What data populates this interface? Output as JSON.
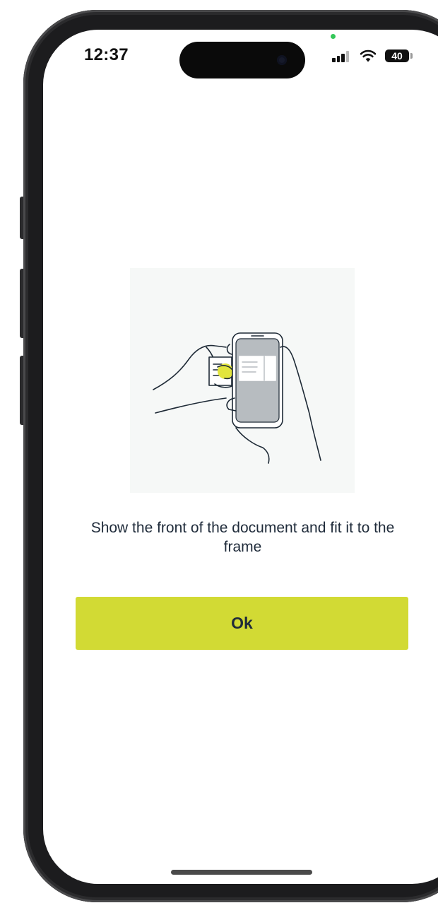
{
  "status_bar": {
    "time": "12:37",
    "battery_level": "40",
    "icons": [
      "signal-icon",
      "wifi-icon",
      "battery-icon"
    ],
    "privacy_indicator_color": "#34c759"
  },
  "content": {
    "illustration_icon": "hand-holding-phone-scanning-card-icon",
    "instruction": "Show the front of the document and fit it to the frame",
    "ok_button_label": "Ok"
  },
  "colors": {
    "accent": "#d2da34",
    "text": "#1f2b3a",
    "illustration_highlight": "#e2e53c"
  }
}
